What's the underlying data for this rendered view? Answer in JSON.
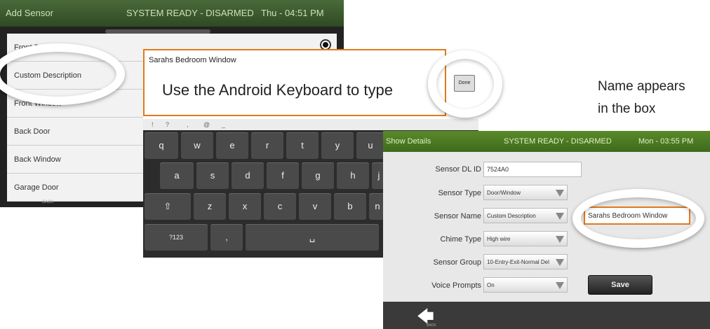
{
  "add_sensor": {
    "title": "Add Sensor",
    "status": "SYSTEM READY - DISARMED",
    "time": "Thu - 04:51 PM",
    "items": [
      "Front Door",
      "Custom Description",
      "Front Window",
      "Back Door",
      "Back Window",
      "Garage Door"
    ],
    "footer": "BACK"
  },
  "keyboard_screen": {
    "typed_text": "Sarahs Bedroom Window",
    "instruction": "Use the Android Keyboard to type",
    "done_label": "Done",
    "symbols": [
      "!",
      "?",
      ",",
      "@",
      "_"
    ],
    "rows": [
      [
        "q",
        "w",
        "e",
        "r",
        "t",
        "y",
        "u"
      ],
      [
        "a",
        "s",
        "d",
        "f",
        "g",
        "h",
        "j"
      ],
      [
        "⇧",
        "z",
        "x",
        "c",
        "v",
        "b",
        "n"
      ],
      [
        "?123",
        ",",
        "␣"
      ]
    ]
  },
  "show_details": {
    "title": "Show Details",
    "status": "SYSTEM READY - DISARMED",
    "time": "Mon - 03:55 PM",
    "fields": {
      "dl_id_label": "Sensor DL ID",
      "dl_id_value": "7524A0",
      "type_label": "Sensor Type",
      "type_value": "Door/Window",
      "name_label": "Sensor Name",
      "name_value": "Custom Description",
      "name_text": "Sarahs Bedroom Window",
      "chime_label": "Chime Type",
      "chime_value": "High wire",
      "group_label": "Sensor Group",
      "group_value": "10-Entry-Exit-Normal Del",
      "voice_label": "Voice Prompts",
      "voice_value": "On"
    },
    "save_label": "Save",
    "back_label": "BACK"
  },
  "annotation": {
    "line1": "Name appears",
    "line2": "in the box"
  }
}
